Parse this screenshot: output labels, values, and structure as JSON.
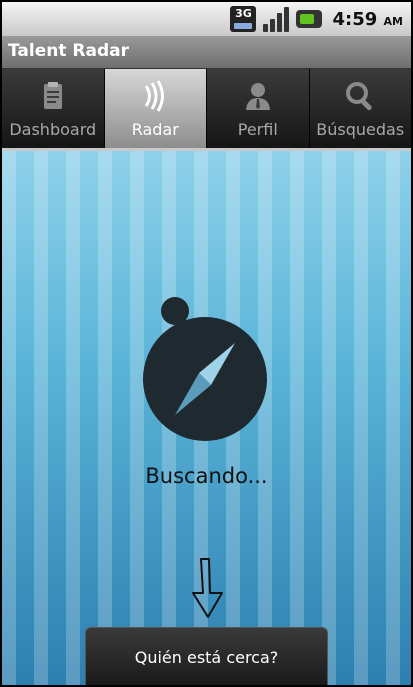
{
  "status_bar": {
    "network_label": "3G",
    "time": "4:59",
    "ampm": "AM"
  },
  "app": {
    "title": "Talent Radar"
  },
  "tabs": [
    {
      "label": "Dashboard",
      "icon": "clipboard-icon",
      "active": false
    },
    {
      "label": "Radar",
      "icon": "radar-waves-icon",
      "active": true
    },
    {
      "label": "Perfil",
      "icon": "person-icon",
      "active": false
    },
    {
      "label": "Búsquedas",
      "icon": "magnifier-icon",
      "active": false
    }
  ],
  "main": {
    "status_text": "Buscando...",
    "icon": "compass-icon",
    "arrow_icon": "arrow-down-icon",
    "action_label": "Quién está cerca?"
  },
  "colors": {
    "accent_background": "#5ab4d8",
    "active_tab": "#d7d7d7"
  }
}
